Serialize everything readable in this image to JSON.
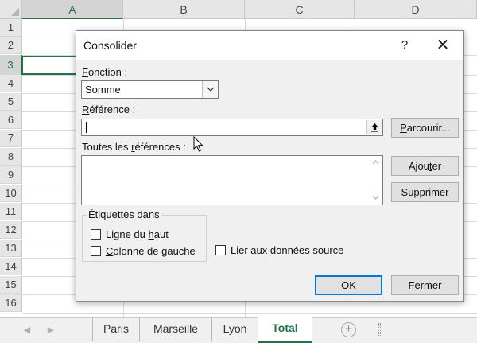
{
  "spreadsheet": {
    "columns": [
      "A",
      "B",
      "C",
      "D"
    ],
    "rows": [
      "1",
      "2",
      "3",
      "4",
      "5",
      "6",
      "7",
      "8",
      "9",
      "10",
      "11",
      "12",
      "13",
      "14",
      "15",
      "16"
    ],
    "active_column": "A",
    "active_row": "3"
  },
  "sheet_tabs": {
    "tabs": [
      "Paris",
      "Marseille",
      "Lyon",
      "Total"
    ],
    "active": "Total",
    "add_symbol": "+"
  },
  "dialog": {
    "title": "Consolider",
    "help_symbol": "?",
    "close_symbol": "✕",
    "function_label": {
      "before": "",
      "underlined": "F",
      "after": "onction :"
    },
    "function_value": "Somme",
    "reference_label": {
      "before": "",
      "underlined": "R",
      "after": "éférence :"
    },
    "reference_value": "",
    "browse_button": {
      "before": "",
      "underlined": "P",
      "after": "arcourir..."
    },
    "all_references_label": {
      "before": "Toutes les ",
      "underlined": "r",
      "after": "éférences :"
    },
    "add_button": {
      "before": "Ajou",
      "underlined": "t",
      "after": "er"
    },
    "delete_button": {
      "before": "",
      "underlined": "S",
      "after": "upprimer"
    },
    "labels_group_title": "Étiquettes dans",
    "top_row_checkbox": {
      "before": "Ligne du ",
      "underlined": "h",
      "after": "aut",
      "checked": false
    },
    "left_column_checkbox": {
      "before": "",
      "underlined": "C",
      "after": "olonne de gauche",
      "checked": false
    },
    "link_source_checkbox": {
      "before": "Lier aux ",
      "underlined": "d",
      "after": "onnées source",
      "checked": false
    },
    "ok_button": "OK",
    "close_button": "Fermer"
  },
  "colors": {
    "excel_green": "#217346",
    "focus_blue": "#0078d7",
    "dialog_bg": "#f0f0f0"
  },
  "icons": {
    "select_arrow": "chevron-down-icon",
    "collapse": "collapse-dialog-icon",
    "scroll_up": "scroll-up-icon",
    "scroll_down": "scroll-down-icon",
    "cursor": "mouse-pointer-icon"
  }
}
